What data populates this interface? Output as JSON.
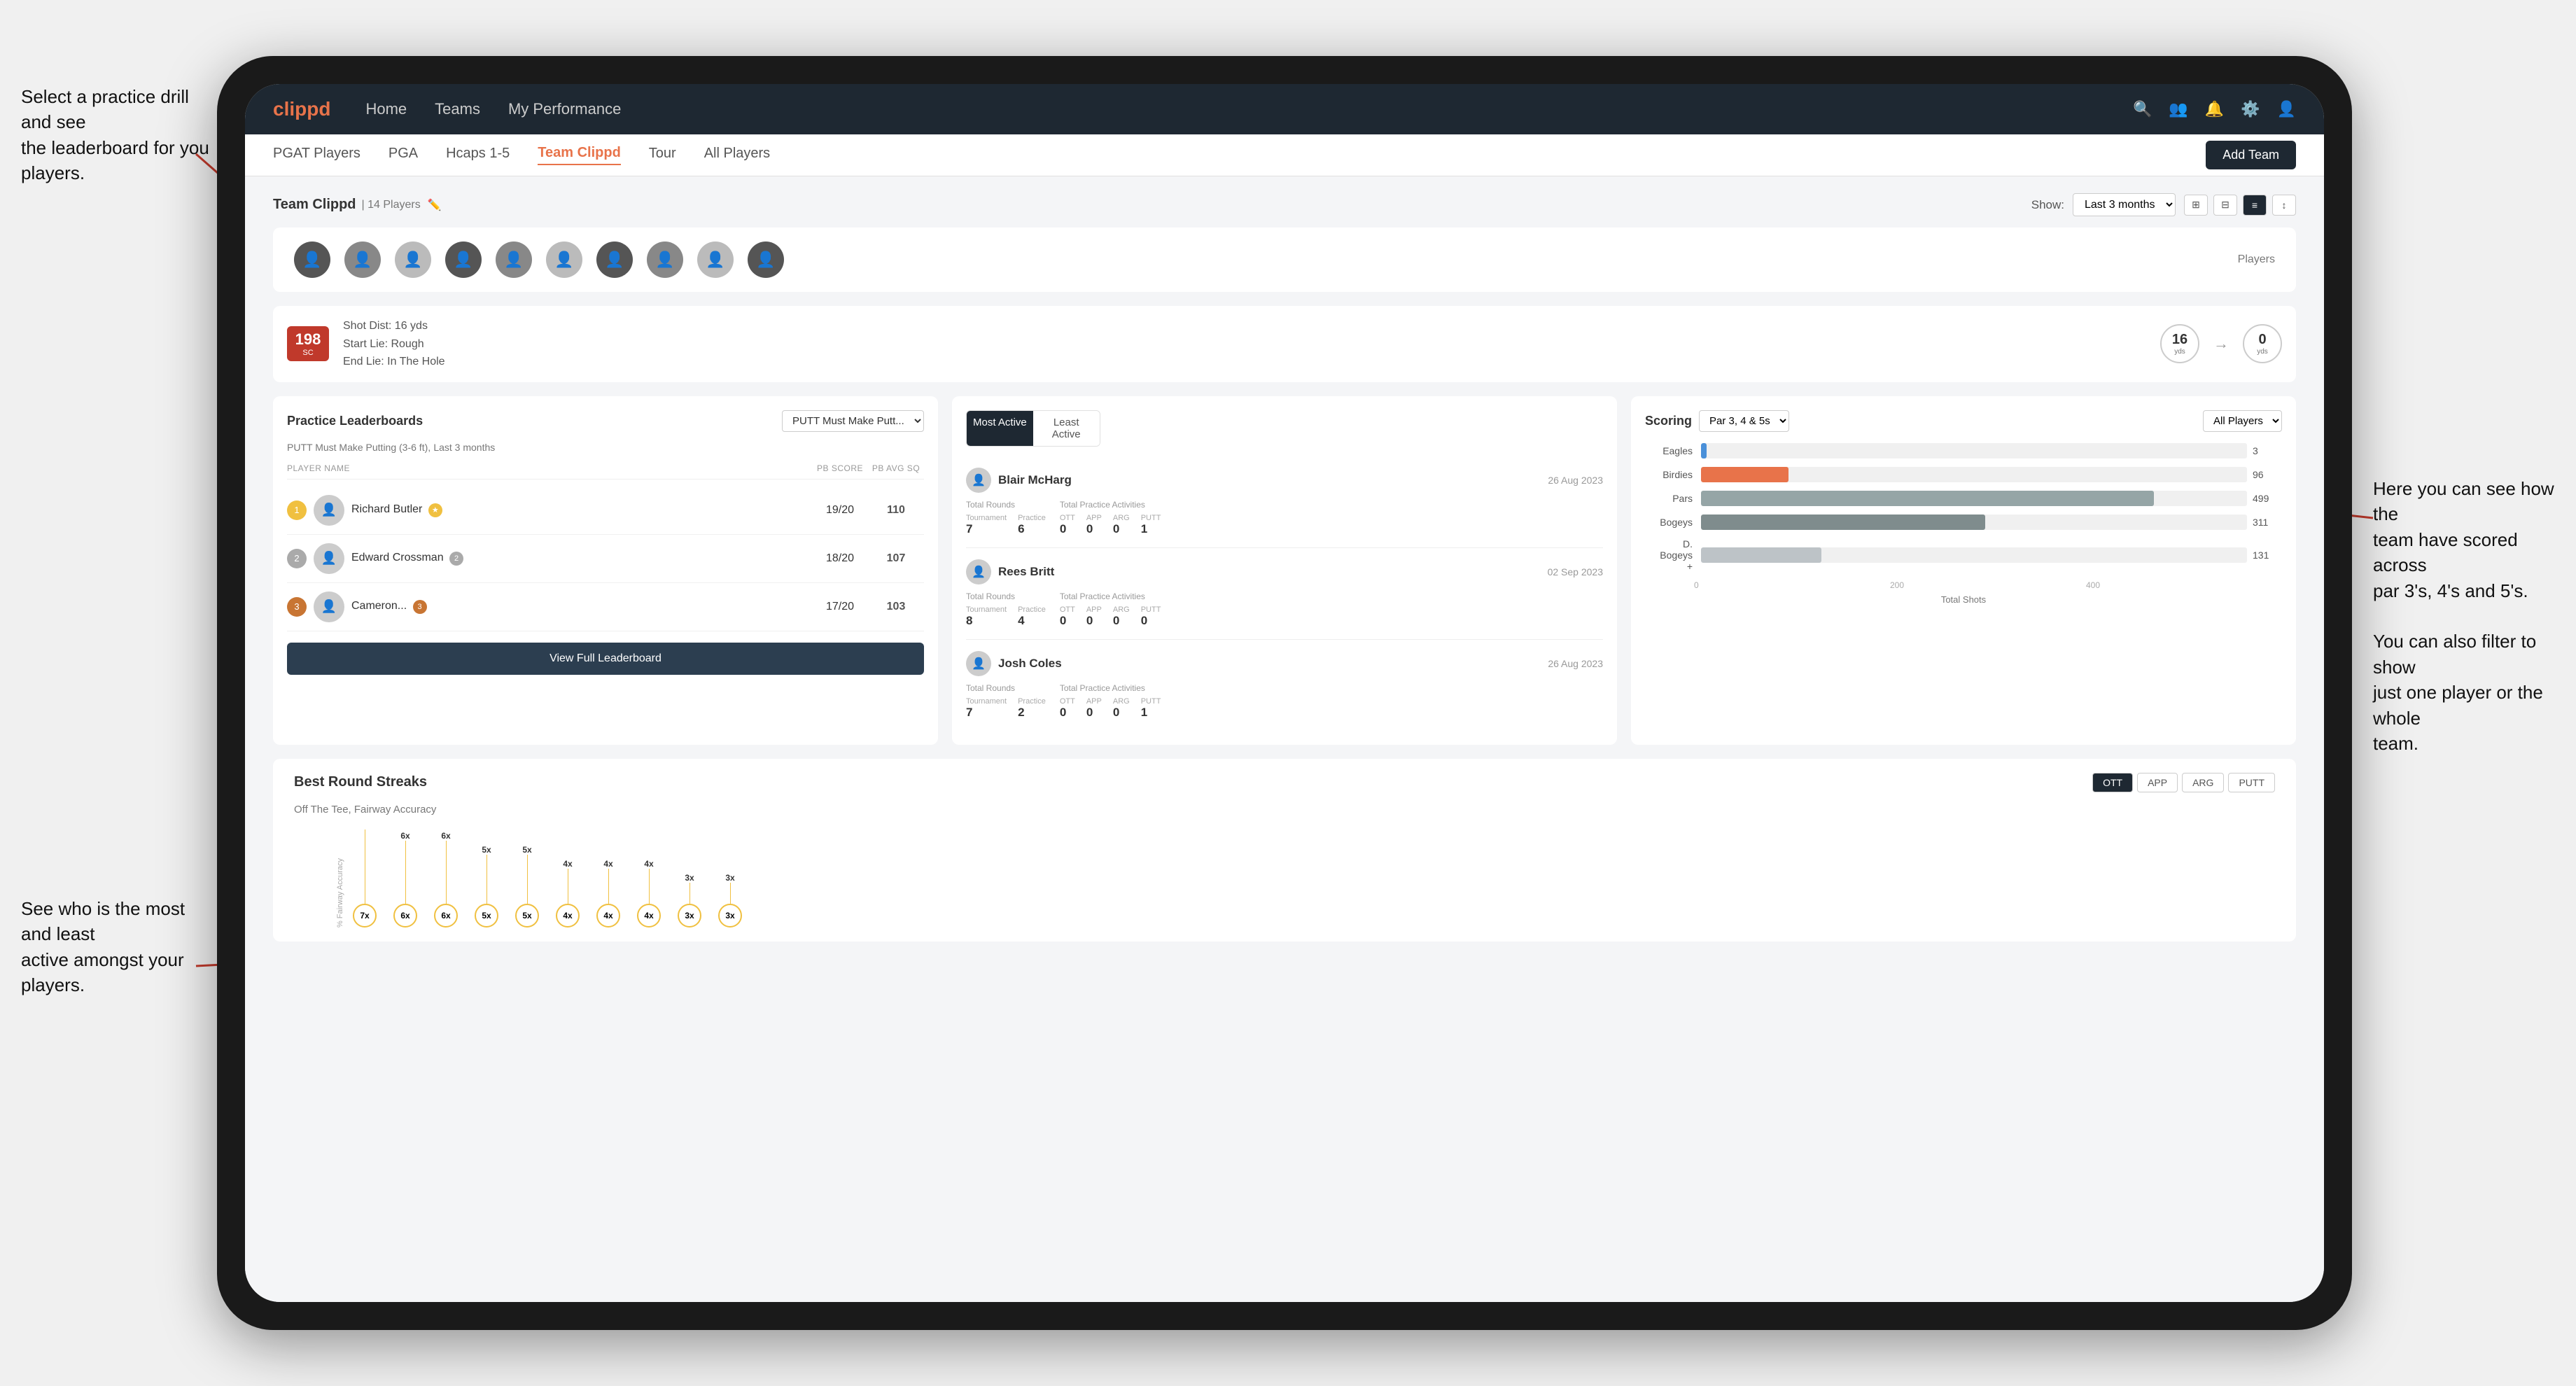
{
  "annotations": {
    "top_left": "Select a practice drill and see\nthe leaderboard for you players.",
    "bottom_left": "See who is the most and least\nactive amongst your players.",
    "right": "Here you can see how the\nteam have scored across\npar 3's, 4's and 5's.\n\nYou can also filter to show\njust one player or the whole\nteam."
  },
  "navbar": {
    "brand": "clippd",
    "links": [
      "Home",
      "Teams",
      "My Performance"
    ],
    "icons": [
      "search",
      "people",
      "bell",
      "settings",
      "user"
    ]
  },
  "subnav": {
    "items": [
      "PGAT Players",
      "PGA",
      "Hcaps 1-5",
      "Team Clippd",
      "Tour",
      "All Players"
    ],
    "active": "Team Clippd",
    "add_team": "Add Team"
  },
  "team": {
    "title": "Team Clippd",
    "count": "14 Players",
    "show_label": "Show:",
    "show_value": "Last 3 months",
    "players_label": "Players"
  },
  "shot": {
    "badge_number": "198",
    "badge_unit": "SC",
    "line1": "Shot Dist: 16 yds",
    "line2": "Start Lie: Rough",
    "line3": "End Lie: In The Hole",
    "circle1_value": "16",
    "circle1_label": "yds",
    "circle2_value": "0",
    "circle2_label": "yds"
  },
  "practice_leaderboard": {
    "title": "Practice Leaderboards",
    "drill": "PUTT Must Make Putt...",
    "subtitle": "PUTT Must Make Putting (3-6 ft),",
    "period": "Last 3 months",
    "headers": {
      "player": "PLAYER NAME",
      "score": "PB SCORE",
      "avg": "PB AVG SQ"
    },
    "players": [
      {
        "rank": 1,
        "name": "Richard Butler",
        "score": "19/20",
        "avg": "110",
        "badge": "gold",
        "num": ""
      },
      {
        "rank": 2,
        "name": "Edward Crossman",
        "score": "18/20",
        "avg": "107",
        "badge": "silver",
        "num": "2"
      },
      {
        "rank": 3,
        "name": "Cameron...",
        "score": "17/20",
        "avg": "103",
        "badge": "bronze",
        "num": "3"
      }
    ],
    "view_full": "View Full Leaderboard"
  },
  "activity": {
    "tabs": [
      "Most Active",
      "Least Active"
    ],
    "active_tab": "Most Active",
    "players": [
      {
        "name": "Blair McHarg",
        "date": "26 Aug 2023",
        "total_rounds_label": "Total Rounds",
        "tournament_label": "Tournament",
        "practice_label": "Practice",
        "tournament_val": "7",
        "practice_val": "6",
        "total_practice_label": "Total Practice Activities",
        "ott_label": "OTT",
        "app_label": "APP",
        "arg_label": "ARG",
        "putt_label": "PUTT",
        "ott_val": "0",
        "app_val": "0",
        "arg_val": "0",
        "putt_val": "1"
      },
      {
        "name": "Rees Britt",
        "date": "02 Sep 2023",
        "total_rounds_label": "Total Rounds",
        "tournament_label": "Tournament",
        "practice_label": "Practice",
        "tournament_val": "8",
        "practice_val": "4",
        "total_practice_label": "Total Practice Activities",
        "ott_label": "OTT",
        "app_label": "APP",
        "arg_label": "ARG",
        "putt_label": "PUTT",
        "ott_val": "0",
        "app_val": "0",
        "arg_val": "0",
        "putt_val": "0"
      },
      {
        "name": "Josh Coles",
        "date": "26 Aug 2023",
        "total_rounds_label": "Total Rounds",
        "tournament_label": "Tournament",
        "practice_label": "Practice",
        "tournament_val": "7",
        "practice_val": "2",
        "total_practice_label": "Total Practice Activities",
        "ott_label": "OTT",
        "app_label": "APP",
        "arg_label": "ARG",
        "putt_label": "PUTT",
        "ott_val": "0",
        "app_val": "0",
        "arg_val": "0",
        "putt_val": "1"
      }
    ]
  },
  "scoring": {
    "title": "Scoring",
    "filter1": "Par 3, 4 & 5s",
    "filter2": "All Players",
    "bars": [
      {
        "label": "Eagles",
        "value": 3,
        "max": 400,
        "color": "eagles",
        "display": "3"
      },
      {
        "label": "Birdies",
        "value": 96,
        "max": 400,
        "color": "birdies",
        "display": "96"
      },
      {
        "label": "Pars",
        "value": 499,
        "max": 600,
        "color": "pars",
        "display": "499"
      },
      {
        "label": "Bogeys",
        "value": 311,
        "max": 600,
        "color": "bogeys",
        "display": "311"
      },
      {
        "label": "D. Bogeys +",
        "value": 131,
        "max": 600,
        "color": "dbogeys",
        "display": "131"
      }
    ],
    "x_axis": [
      "0",
      "200",
      "400"
    ],
    "x_label": "Total Shots"
  },
  "streaks": {
    "title": "Best Round Streaks",
    "buttons": [
      "OTT",
      "APP",
      "ARG",
      "PUTT"
    ],
    "active_btn": "OTT",
    "subtitle": "Off The Tee, Fairway Accuracy",
    "y_axis_label": "% Fairway Accuracy",
    "dots": [
      {
        "label": "7x",
        "height": 120
      },
      {
        "label": "6x",
        "height": 100
      },
      {
        "label": "6x",
        "height": 100
      },
      {
        "label": "5x",
        "height": 80
      },
      {
        "label": "5x",
        "height": 80
      },
      {
        "label": "4x",
        "height": 60
      },
      {
        "label": "4x",
        "height": 60
      },
      {
        "label": "4x",
        "height": 60
      },
      {
        "label": "3x",
        "height": 40
      },
      {
        "label": "3x",
        "height": 40
      }
    ]
  }
}
